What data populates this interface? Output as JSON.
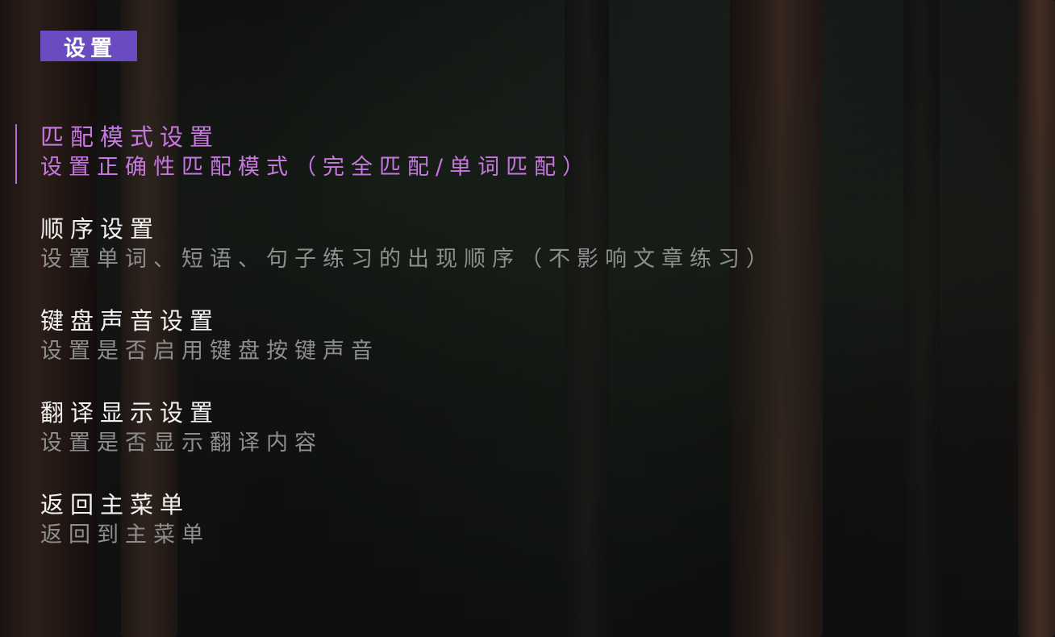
{
  "header": {
    "title": "设置",
    "accent_color": "#6a4cc0"
  },
  "menu": {
    "selected_index": 0,
    "selected_color": "#c777e0",
    "items": [
      {
        "label": "匹配模式设置",
        "description": "设置正确性匹配模式（完全匹配/单词匹配）"
      },
      {
        "label": "顺序设置",
        "description": "设置单词、短语、句子练习的出现顺序（不影响文章练习）"
      },
      {
        "label": "键盘声音设置",
        "description": "设置是否启用键盘按键声音"
      },
      {
        "label": "翻译显示设置",
        "description": "设置是否显示翻译内容"
      },
      {
        "label": "返回主菜单",
        "description": "返回到主菜单"
      }
    ]
  }
}
